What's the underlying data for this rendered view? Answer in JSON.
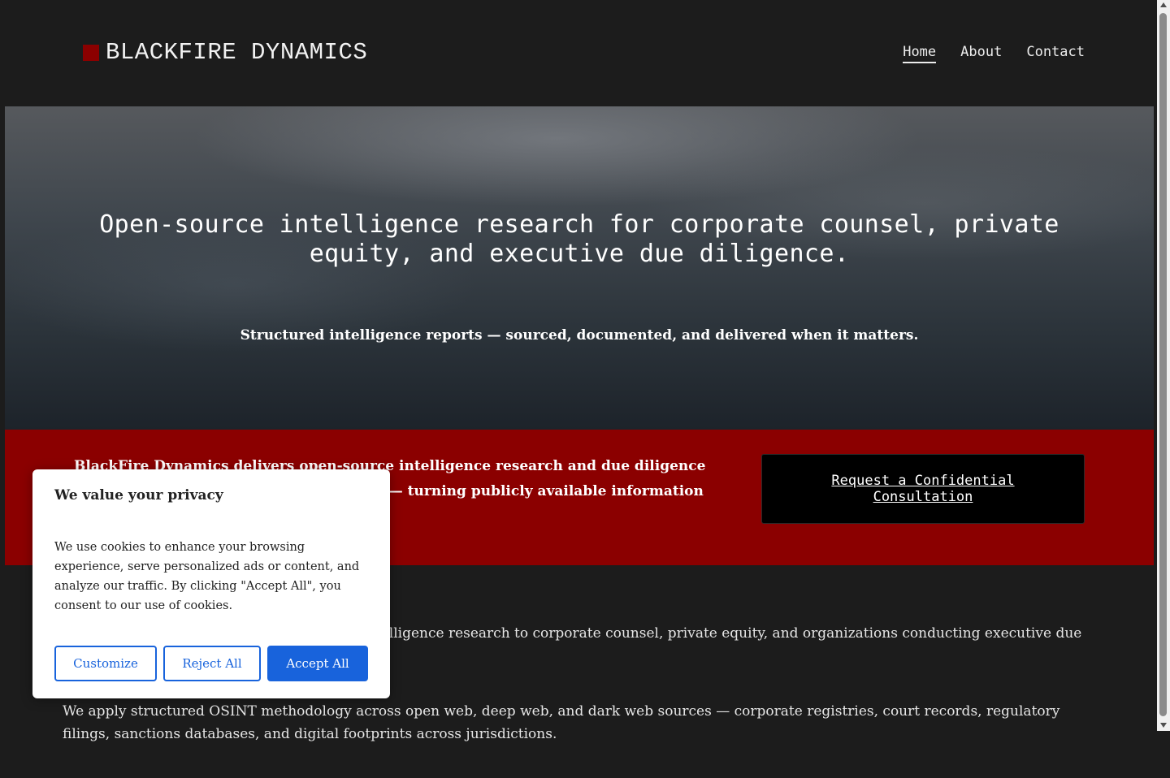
{
  "header": {
    "brand": "BLACKFIRE DYNAMICS",
    "nav": [
      {
        "label": "Home",
        "active": true
      },
      {
        "label": "About",
        "active": false
      },
      {
        "label": "Contact",
        "active": false
      }
    ]
  },
  "hero": {
    "headline": "Open-source intelligence research for corporate counsel, private equity, and executive due diligence.",
    "subheadline": "Structured intelligence reports — sourced, documented, and delivered when it matters."
  },
  "banner": {
    "text": "BlackFire Dynamics delivers open-source intelligence research and due diligence to corporate counsel, and private equity — turning publicly available information into actionable intelligence.",
    "cta_label": "Request a Confidential Consultation"
  },
  "content": {
    "paragraphs": [
      "BlackFire Dynamics provides open-source intelligence research to corporate counsel, private equity, and organizations conducting executive due diligence.",
      "We apply structured OSINT methodology across open web, deep web, and dark web sources — corporate registries, court records, regulatory filings, sanctions databases, and digital footprints across jurisdictions."
    ]
  },
  "cookie": {
    "title": "We value your privacy",
    "body": "We use cookies to enhance your browsing experience, serve personalized ads or content, and analyze our traffic. By clicking \"Accept All\", you consent to our use of cookies.",
    "customize": "Customize",
    "reject": "Reject All",
    "accept": "Accept All"
  },
  "colors": {
    "background": "#1c1c1c",
    "brand_red": "#8b0000",
    "cookie_blue": "#1863dc",
    "cta_black": "#000000"
  }
}
